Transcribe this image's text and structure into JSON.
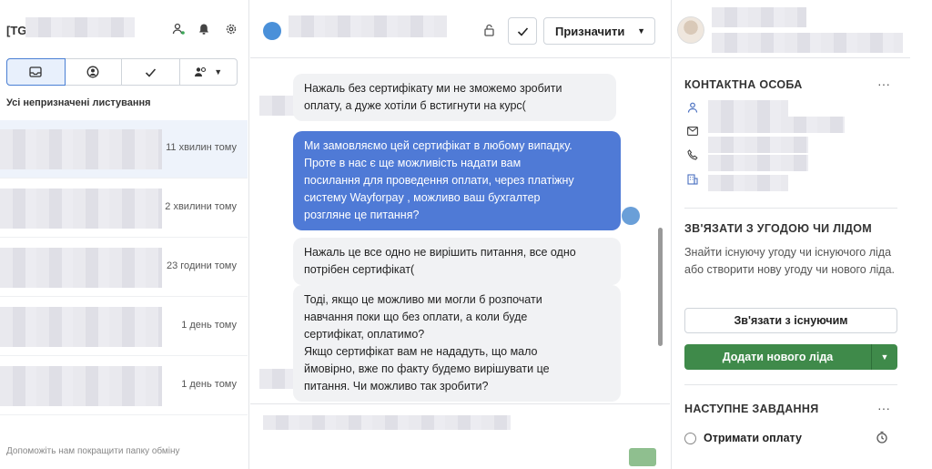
{
  "left": {
    "title": "[TG",
    "filter_label": "Усі непризначені листування",
    "footer": "Допоможіть нам покращити папку обміну",
    "conversations": [
      {
        "time": "11 хвилин тому"
      },
      {
        "time": "2 хвилини тому"
      },
      {
        "time": "23 години тому"
      },
      {
        "time": "1 день тому"
      },
      {
        "time": "1 день тому"
      }
    ]
  },
  "middle": {
    "assign_label": "Призначити",
    "messages": [
      {
        "dir": "in",
        "text": "Нажаль без сертифікату ми не зможемо зробити\nоплату, а дуже хотіли б встигнути на курс("
      },
      {
        "dir": "out",
        "text": "Ми замовляємо цей сертифікат в любому випадку.\nПроте в нас є ще можливість надати вам\nпосилання для проведення оплати, через платіжну\nсистему Wayforpay , можливо ваш бухгалтер\nрозгляне це питання?"
      },
      {
        "dir": "in",
        "text": "Нажаль це все одно не вирішить питання, все одно\nпотрібен сертифікат("
      },
      {
        "dir": "in",
        "text": "Тоді, якщо це можливо ми могли б розпочати\nнавчання поки що без оплати, а коли буде\nсертифікат, оплатимо?\nЯкщо сертифікат вам не нададуть, що мало\nймовірно, вже по факту будемо вирішувати це\nпитання. Чи можливо так зробити?"
      }
    ]
  },
  "right": {
    "contact_title": "КОНТАКТНА ОСОБА",
    "link_title": "ЗВ'ЯЗАТИ З УГОДОЮ ЧИ ЛІДОМ",
    "link_desc": "Знайти існуючу угоду чи існуючого ліда або створити нову угоду чи нового ліда.",
    "link_existing_label": "Зв'язати з існуючим",
    "add_lead_label": "Додати нового ліда",
    "next_task_title": "НАСТУПНЕ ЗАВДАННЯ",
    "task_label": "Отримати оплату",
    "more": "···"
  },
  "colors": {
    "accent": "#4f7ad6",
    "green": "#3f8a4a"
  }
}
